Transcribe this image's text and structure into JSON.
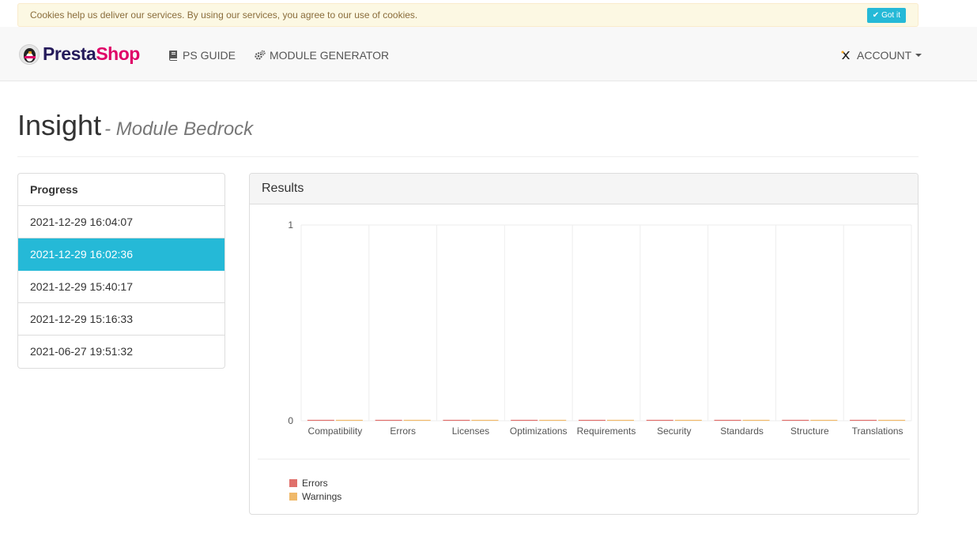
{
  "cookie": {
    "text": "Cookies help us deliver our services. By using our services, you agree to our use of cookies.",
    "button": "Got it"
  },
  "nav": {
    "brand_a": "Presta",
    "brand_b": "Shop",
    "guide": "PS GUIDE",
    "generator": "MODULE GENERATOR",
    "account": "ACCOUNT"
  },
  "page": {
    "title": "Insight",
    "subtitle": "- Module Bedrock"
  },
  "progress": {
    "heading": "Progress",
    "items": [
      "2021-12-29 16:04:07",
      "2021-12-29 16:02:36",
      "2021-12-29 15:40:17",
      "2021-12-29 15:16:33",
      "2021-06-27 19:51:32"
    ],
    "active_index": 1
  },
  "results": {
    "heading": "Results"
  },
  "chart_data": {
    "type": "bar",
    "categories": [
      "Compatibility",
      "Errors",
      "Licenses",
      "Optimizations",
      "Requirements",
      "Security",
      "Standards",
      "Structure",
      "Translations"
    ],
    "series": [
      {
        "name": "Errors",
        "values": [
          0,
          0,
          0,
          0,
          0,
          0,
          0,
          0,
          0
        ],
        "color": "#e0706b"
      },
      {
        "name": "Warnings",
        "values": [
          0,
          0,
          0,
          0,
          0,
          0,
          0,
          0,
          0
        ],
        "color": "#f0b96a"
      }
    ],
    "ylim": [
      0,
      1
    ],
    "yticks": [
      "0",
      "1"
    ],
    "legend": "bottom-left",
    "grid": true
  },
  "colors": {
    "accent": "#25b9d7",
    "brand_dark": "#251b5b",
    "brand_pink": "#df0067"
  }
}
